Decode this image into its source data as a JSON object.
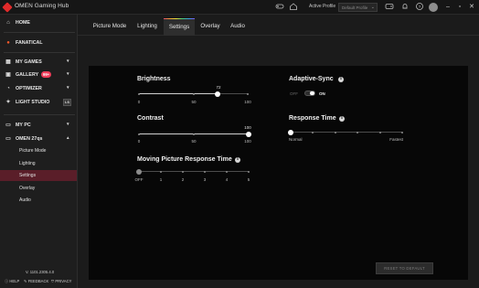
{
  "titlebar": {
    "app_title": "OMEN Gaming Hub",
    "active_profile_label": "Active Profile",
    "profile_value": "Default Profile",
    "icons": [
      "gamepad-icon",
      "bell-icon",
      "help-icon",
      "home-icon"
    ]
  },
  "sidebar": {
    "home": "HOME",
    "fanatical": "FANATICAL",
    "my_games": "MY GAMES",
    "gallery": "GALLERY",
    "gallery_count": "99+",
    "optimizer": "OPTIMIZER",
    "light_studio": "LIGHT STUDIO",
    "light_studio_badge": "LS",
    "my_pc": "MY PC",
    "device": "OMEN 27qs",
    "sub_items": [
      "Picture Mode",
      "Lighting",
      "Settings",
      "Overlay",
      "Audio"
    ],
    "active_sub_item": "Settings",
    "version": "V. 1101.2305.4.0",
    "footer": {
      "help": "HELP",
      "feedback": "FEEDBACK",
      "privacy": "PRIVACY"
    }
  },
  "tabs": {
    "items": [
      "Picture Mode",
      "Lighting",
      "Settings",
      "Overlay",
      "Audio"
    ],
    "active": "Settings"
  },
  "settings": {
    "brightness": {
      "title": "Brightness",
      "value": "72",
      "min_label": "0",
      "mid_label": "50",
      "max_label": "100",
      "value_fraction": 0.72
    },
    "contrast": {
      "title": "Contrast",
      "value": "100",
      "min_label": "0",
      "mid_label": "50",
      "max_label": "100",
      "value_fraction": 1.0
    },
    "moving_picture_response_time": {
      "title": "Moving Picture Response Time",
      "labels": [
        "OFF",
        "1",
        "2",
        "3",
        "4",
        "5"
      ],
      "selected": "OFF"
    },
    "adaptive_sync": {
      "title": "Adaptive-Sync",
      "off_label": "OFF",
      "on_label": "ON",
      "state": "ON"
    },
    "response_time": {
      "title": "Response Time",
      "min_label": "Normal",
      "max_label": "Fastest",
      "selected_index": 0,
      "steps": 6
    },
    "reset_label": "RESET TO DEFAULT"
  }
}
